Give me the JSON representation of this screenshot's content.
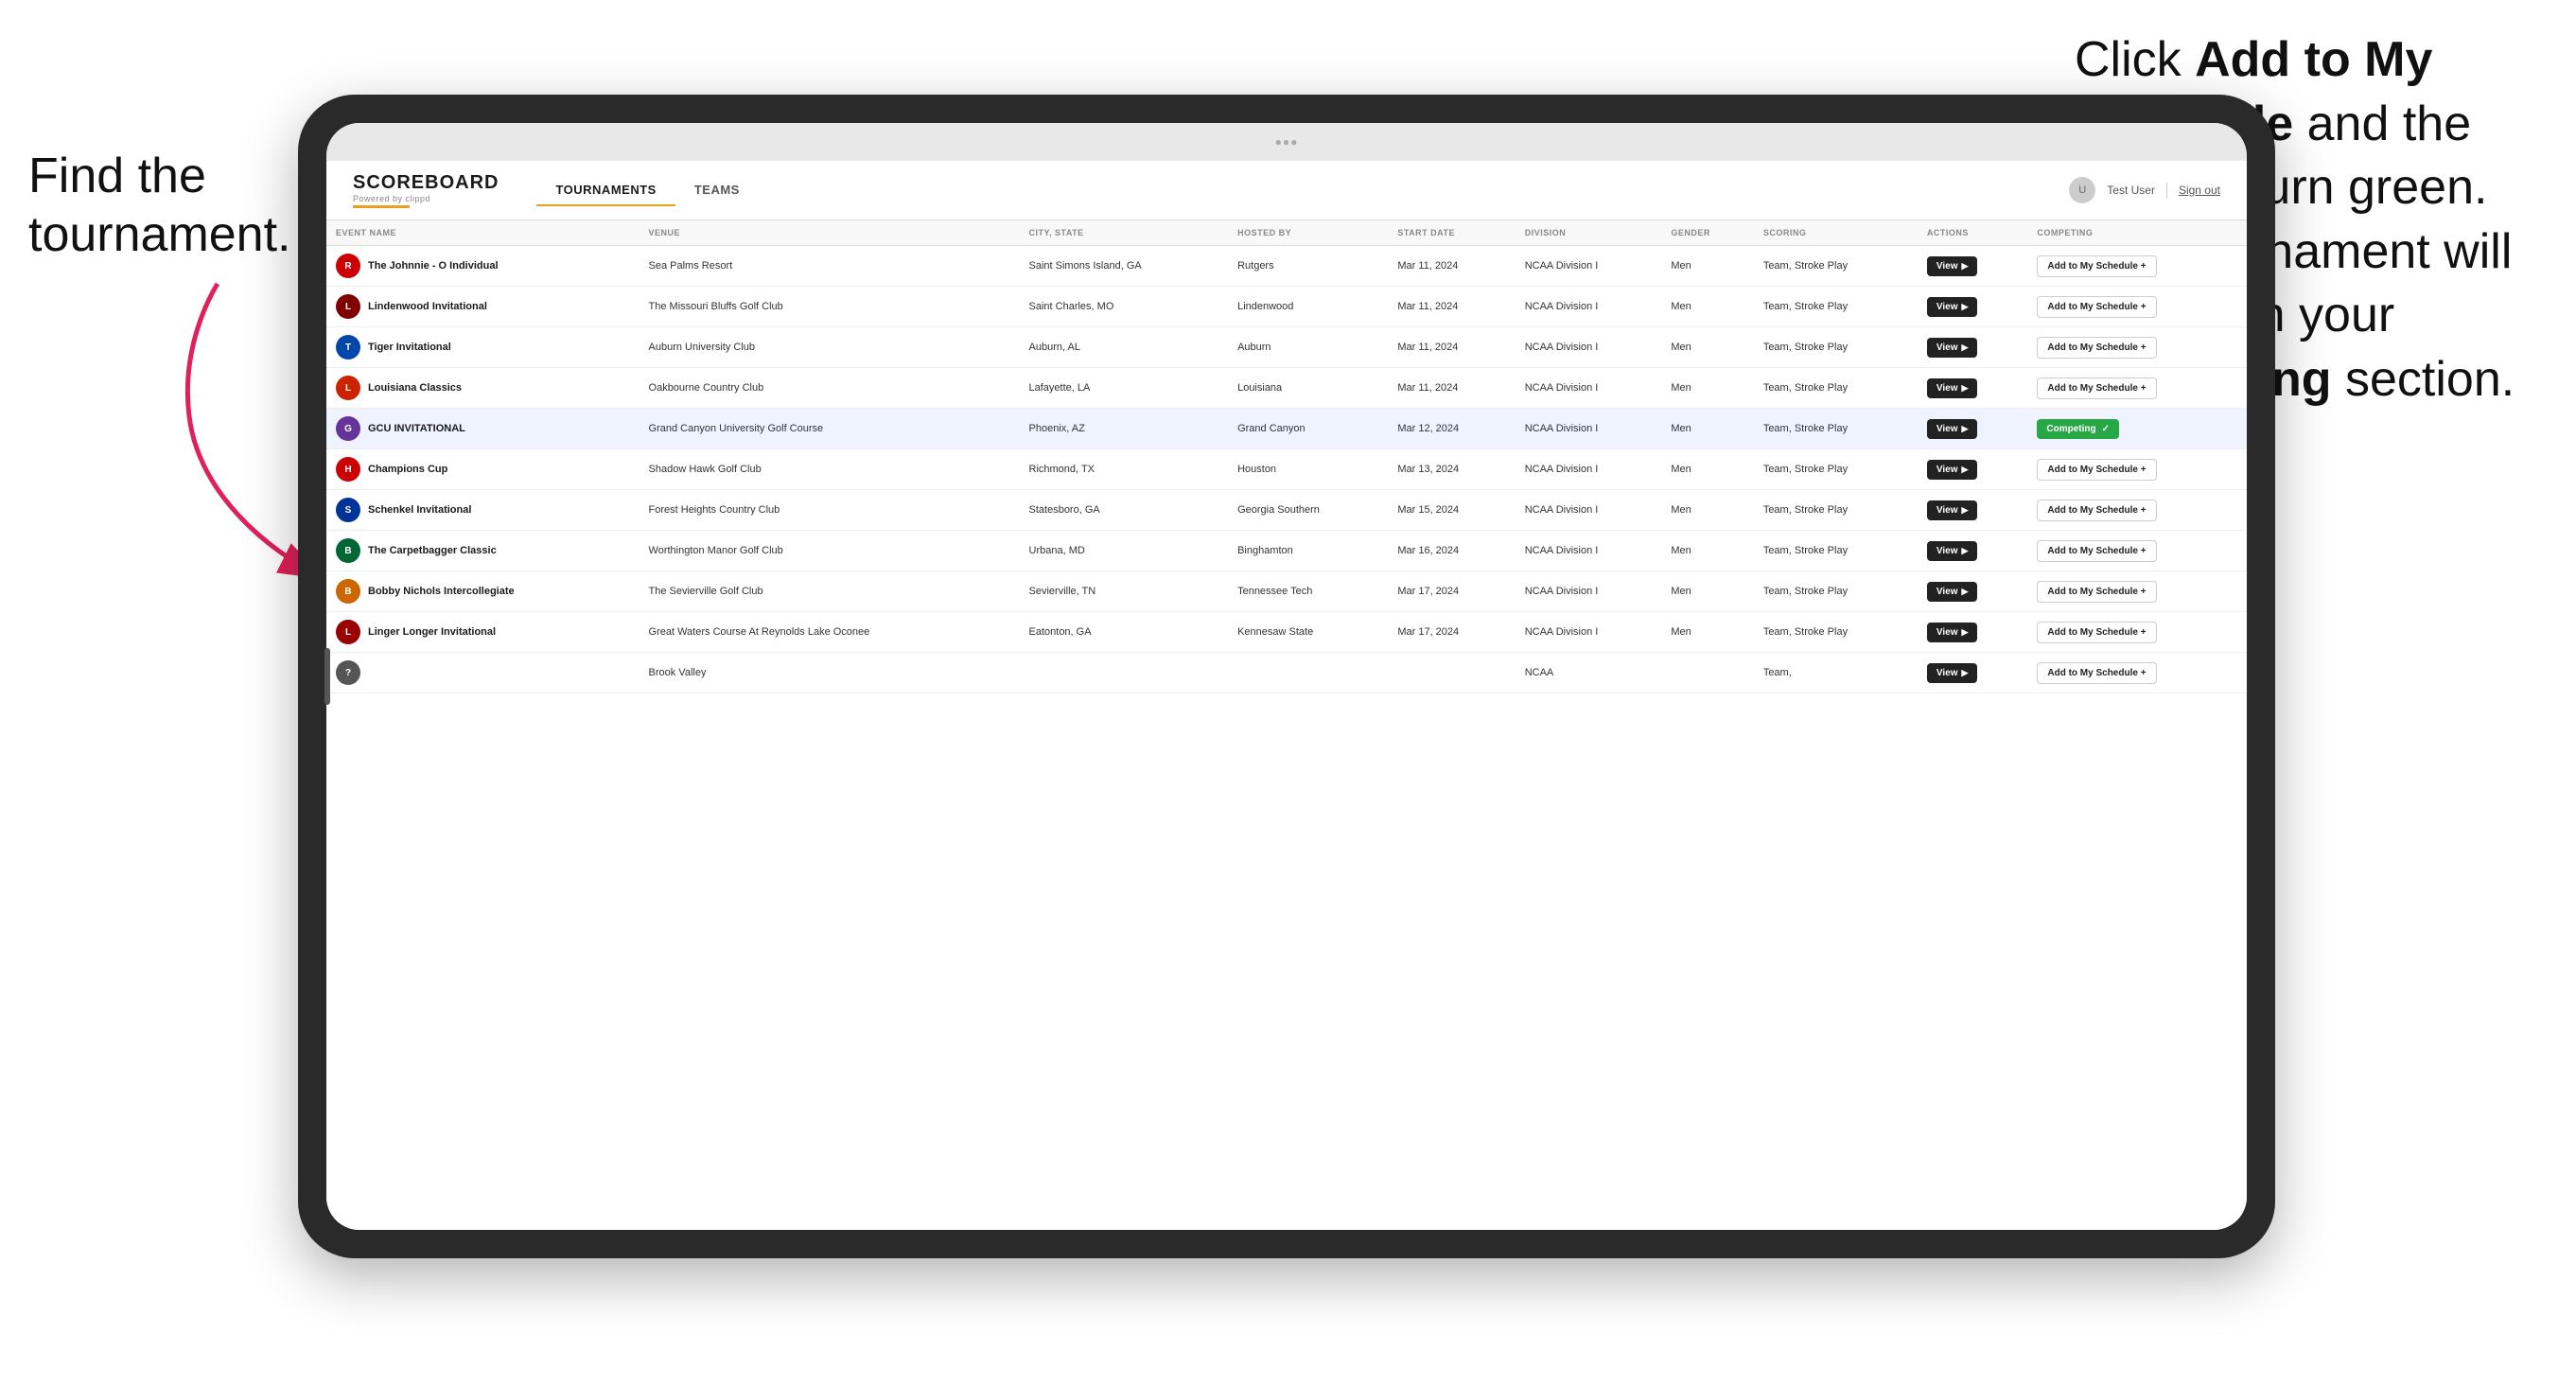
{
  "annotations": {
    "left_title": "Find the",
    "left_title2": "tournament.",
    "right_text_1": "Click ",
    "right_bold_1": "Add to My Schedule",
    "right_text_2": " and the box will turn green. This tournament will now be in your ",
    "right_bold_2": "Competing",
    "right_text_3": " section."
  },
  "nav": {
    "logo": "SCOREBOARD",
    "logo_sub": "Powered by clippd",
    "tab_tournaments": "TOURNAMENTS",
    "tab_teams": "TEAMS",
    "user": "Test User",
    "signout": "Sign out"
  },
  "table": {
    "columns": [
      "EVENT NAME",
      "VENUE",
      "CITY, STATE",
      "HOSTED BY",
      "START DATE",
      "DIVISION",
      "GENDER",
      "SCORING",
      "ACTIONS",
      "COMPETING"
    ],
    "rows": [
      {
        "logo_color": "#cc0000",
        "logo_letter": "R",
        "event_name": "The Johnnie - O Individual",
        "venue": "Sea Palms Resort",
        "city_state": "Saint Simons Island, GA",
        "hosted_by": "Rutgers",
        "start_date": "Mar 11, 2024",
        "division": "NCAA Division I",
        "gender": "Men",
        "scoring": "Team, Stroke Play",
        "action_label": "View",
        "competing_label": "Add to My Schedule +",
        "competing_status": "add"
      },
      {
        "logo_color": "#800000",
        "logo_letter": "L",
        "event_name": "Lindenwood Invitational",
        "venue": "The Missouri Bluffs Golf Club",
        "city_state": "Saint Charles, MO",
        "hosted_by": "Lindenwood",
        "start_date": "Mar 11, 2024",
        "division": "NCAA Division I",
        "gender": "Men",
        "scoring": "Team, Stroke Play",
        "action_label": "View",
        "competing_label": "Add to My Schedule +",
        "competing_status": "add"
      },
      {
        "logo_color": "#0047ab",
        "logo_letter": "T",
        "event_name": "Tiger Invitational",
        "venue": "Auburn University Club",
        "city_state": "Auburn, AL",
        "hosted_by": "Auburn",
        "start_date": "Mar 11, 2024",
        "division": "NCAA Division I",
        "gender": "Men",
        "scoring": "Team, Stroke Play",
        "action_label": "View",
        "competing_label": "Add to My Schedule +",
        "competing_status": "add"
      },
      {
        "logo_color": "#cc2200",
        "logo_letter": "L",
        "event_name": "Louisiana Classics",
        "venue": "Oakbourne Country Club",
        "city_state": "Lafayette, LA",
        "hosted_by": "Louisiana",
        "start_date": "Mar 11, 2024",
        "division": "NCAA Division I",
        "gender": "Men",
        "scoring": "Team, Stroke Play",
        "action_label": "View",
        "competing_label": "Add to My Schedule +",
        "competing_status": "add"
      },
      {
        "logo_color": "#663399",
        "logo_letter": "G",
        "event_name": "GCU INVITATIONAL",
        "venue": "Grand Canyon University Golf Course",
        "city_state": "Phoenix, AZ",
        "hosted_by": "Grand Canyon",
        "start_date": "Mar 12, 2024",
        "division": "NCAA Division I",
        "gender": "Men",
        "scoring": "Team, Stroke Play",
        "action_label": "View",
        "competing_label": "Competing ✓",
        "competing_status": "competing",
        "highlighted": true
      },
      {
        "logo_color": "#cc0000",
        "logo_letter": "H",
        "event_name": "Champions Cup",
        "venue": "Shadow Hawk Golf Club",
        "city_state": "Richmond, TX",
        "hosted_by": "Houston",
        "start_date": "Mar 13, 2024",
        "division": "NCAA Division I",
        "gender": "Men",
        "scoring": "Team, Stroke Play",
        "action_label": "View",
        "competing_label": "Add to My Schedule +",
        "competing_status": "add"
      },
      {
        "logo_color": "#003399",
        "logo_letter": "S",
        "event_name": "Schenkel Invitational",
        "venue": "Forest Heights Country Club",
        "city_state": "Statesboro, GA",
        "hosted_by": "Georgia Southern",
        "start_date": "Mar 15, 2024",
        "division": "NCAA Division I",
        "gender": "Men",
        "scoring": "Team, Stroke Play",
        "action_label": "View",
        "competing_label": "Add to My Schedule +",
        "competing_status": "add"
      },
      {
        "logo_color": "#006633",
        "logo_letter": "B",
        "event_name": "The Carpetbagger Classic",
        "venue": "Worthington Manor Golf Club",
        "city_state": "Urbana, MD",
        "hosted_by": "Binghamton",
        "start_date": "Mar 16, 2024",
        "division": "NCAA Division I",
        "gender": "Men",
        "scoring": "Team, Stroke Play",
        "action_label": "View",
        "competing_label": "Add to My Schedule +",
        "competing_status": "add"
      },
      {
        "logo_color": "#cc6600",
        "logo_letter": "B",
        "event_name": "Bobby Nichols Intercollegiate",
        "venue": "The Sevierville Golf Club",
        "city_state": "Sevierville, TN",
        "hosted_by": "Tennessee Tech",
        "start_date": "Mar 17, 2024",
        "division": "NCAA Division I",
        "gender": "Men",
        "scoring": "Team, Stroke Play",
        "action_label": "View",
        "competing_label": "Add to My Schedule +",
        "competing_status": "add"
      },
      {
        "logo_color": "#990000",
        "logo_letter": "L",
        "event_name": "Linger Longer Invitational",
        "venue": "Great Waters Course At Reynolds Lake Oconee",
        "city_state": "Eatonton, GA",
        "hosted_by": "Kennesaw State",
        "start_date": "Mar 17, 2024",
        "division": "NCAA Division I",
        "gender": "Men",
        "scoring": "Team, Stroke Play",
        "action_label": "View",
        "competing_label": "Add to My Schedule +",
        "competing_status": "add"
      },
      {
        "logo_color": "#555",
        "logo_letter": "?",
        "event_name": "",
        "venue": "Brook Valley",
        "city_state": "",
        "hosted_by": "",
        "start_date": "",
        "division": "NCAA",
        "gender": "",
        "scoring": "Team,",
        "action_label": "View",
        "competing_label": "Add to My Schedule +",
        "competing_status": "add"
      }
    ]
  }
}
